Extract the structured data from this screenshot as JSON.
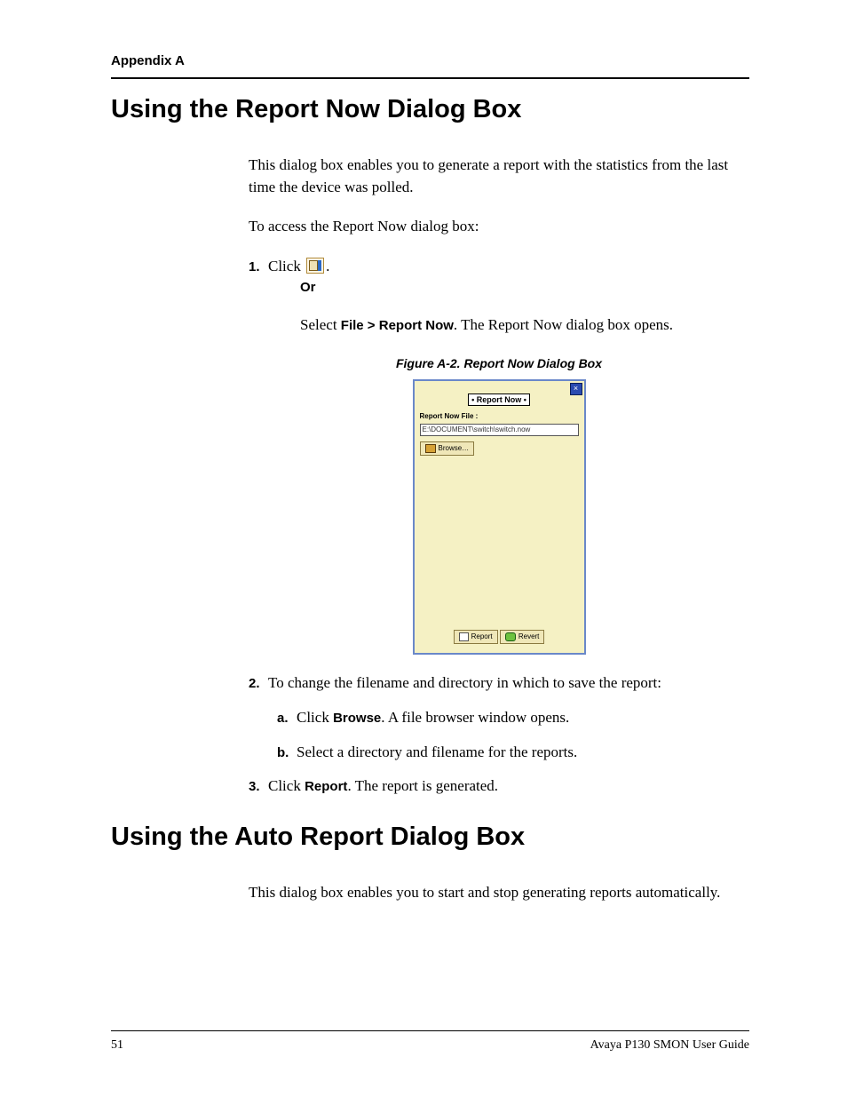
{
  "header": "Appendix A",
  "h1": "Using the Report Now Dialog Box",
  "p1": "This dialog box enables you to generate a report with the statistics from the last time the device was polled.",
  "p2": "To access the Report Now dialog box:",
  "step1_a": "Click ",
  "step1_b": ".",
  "or_label": "Or",
  "step1_sub_a": "Select ",
  "step1_sub_bold": "File > Report Now",
  "step1_sub_b": ". The Report Now dialog box opens.",
  "figcaption": "Figure A-2.  Report Now Dialog Box",
  "dialog": {
    "title": "• Report Now •",
    "file_label": "Report Now File :",
    "file_value": "E:\\DOCUMENT\\switch\\switch.now",
    "browse": "Browse…",
    "report": "Report",
    "revert": "Revert",
    "close": "×"
  },
  "step2": "To change the filename and directory in which to save the report:",
  "step2a_a": "Click ",
  "step2a_bold": "Browse",
  "step2a_b": ". A file browser window opens.",
  "step2b": "Select a directory and filename for the reports.",
  "step3_a": "Click ",
  "step3_bold": "Report",
  "step3_b": ". The report is generated.",
  "h2": "Using the Auto Report Dialog Box",
  "p3": "This dialog box enables you to start and stop generating reports automatically.",
  "footer_left": "51",
  "footer_right": "Avaya P130 SMON User Guide"
}
